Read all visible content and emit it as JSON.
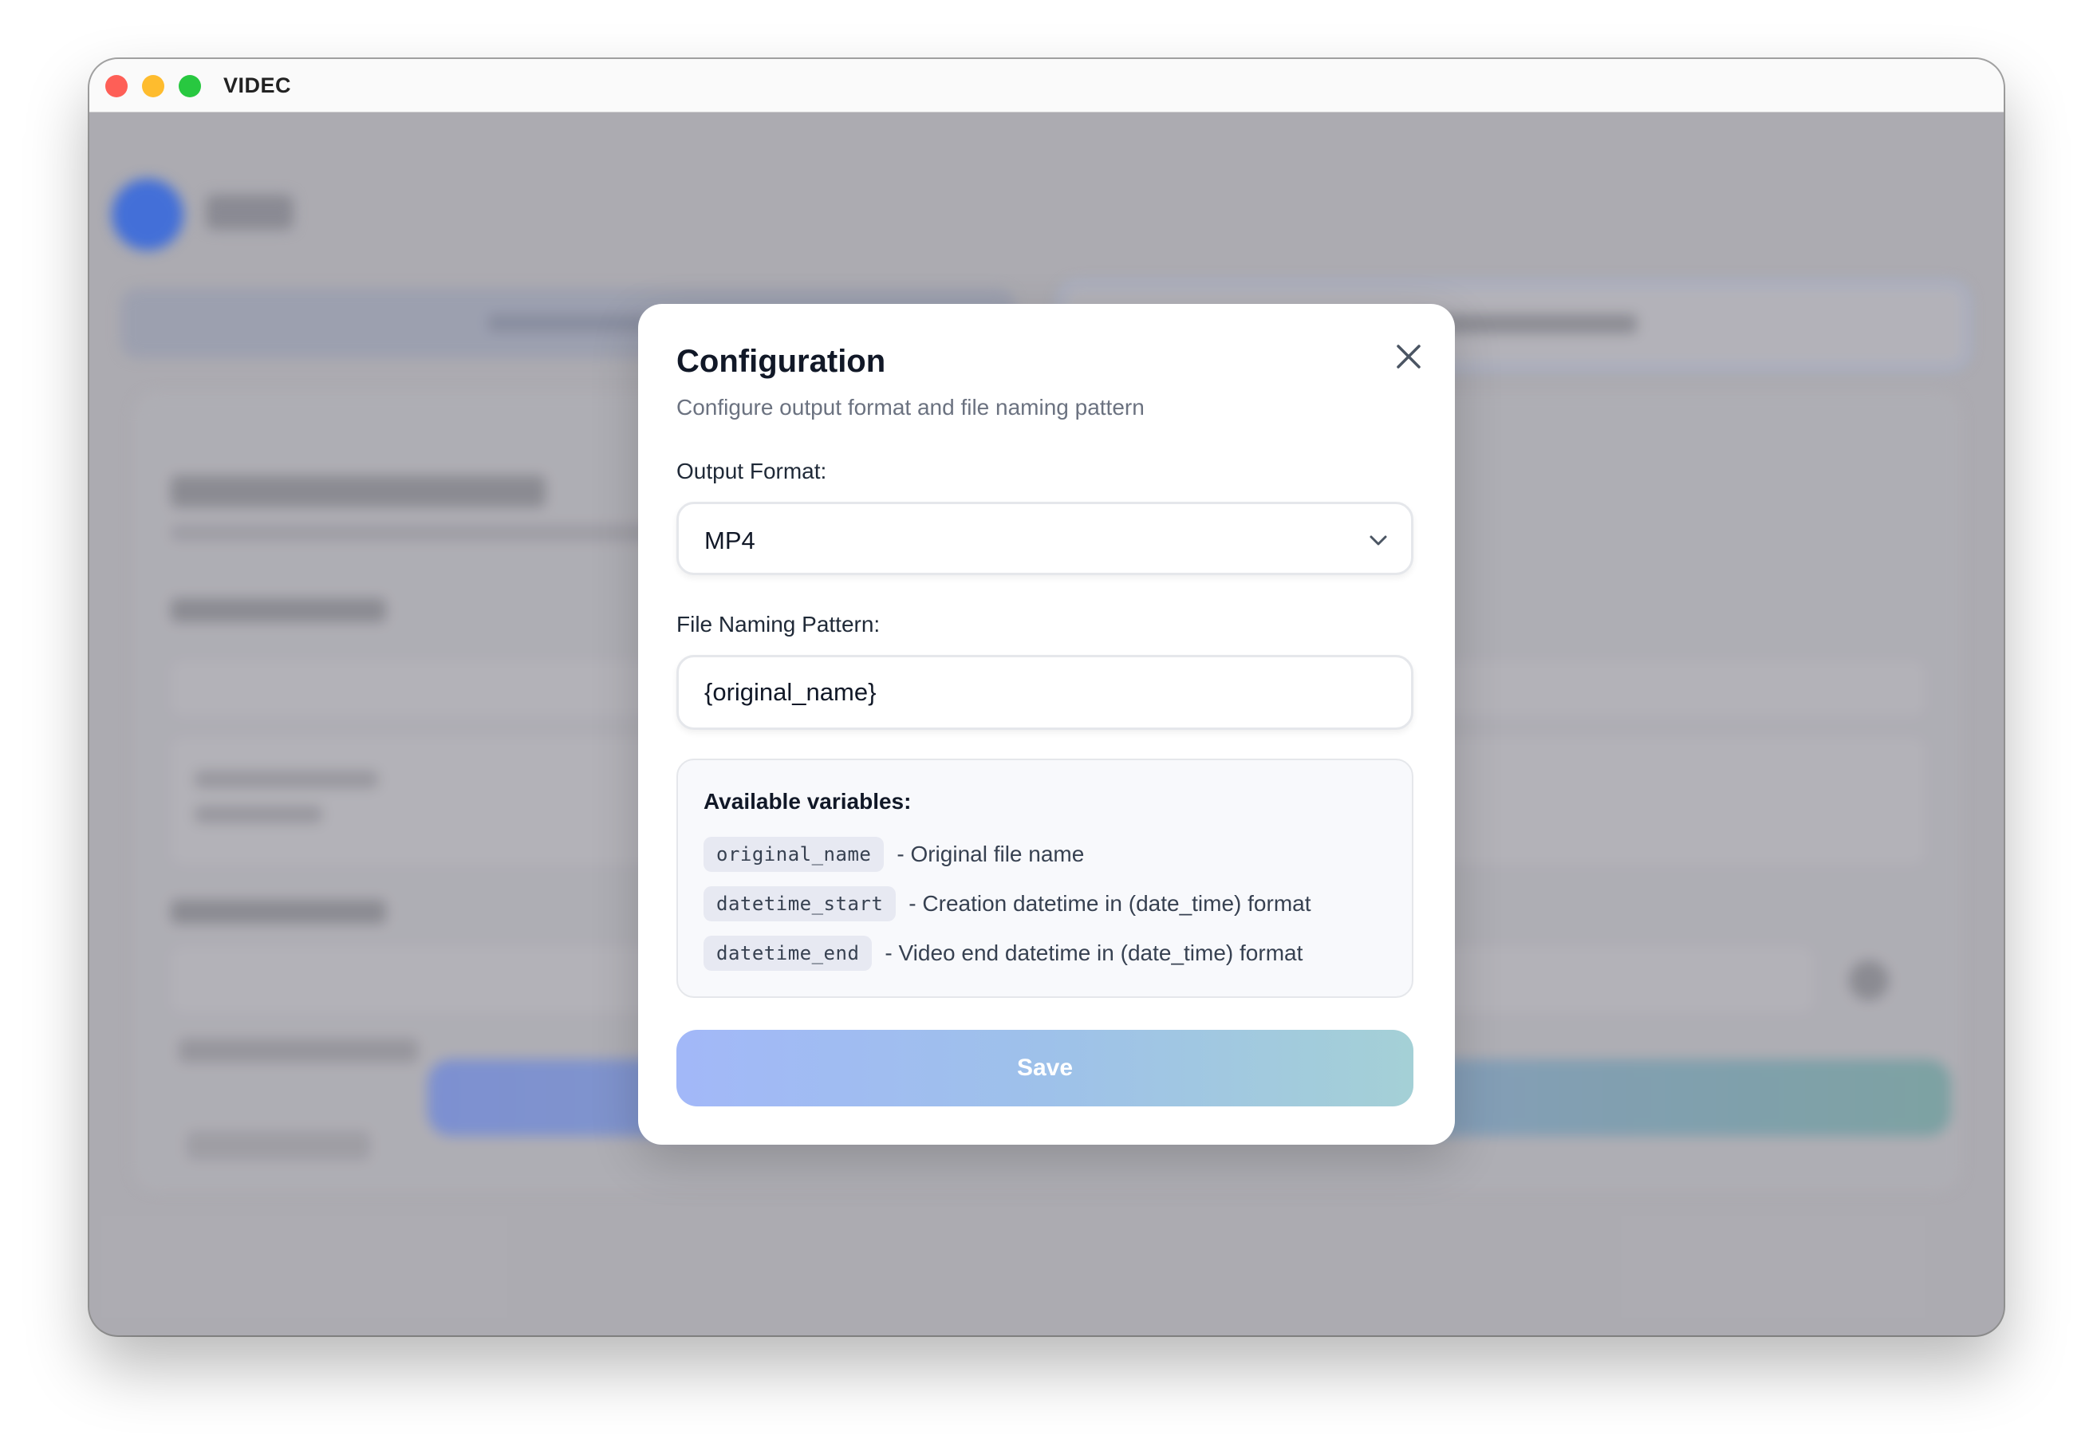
{
  "window": {
    "title": "VIDEC"
  },
  "dialog": {
    "title": "Configuration",
    "subtitle": "Configure output format and file naming pattern",
    "close_icon": "close-icon",
    "output_format": {
      "label": "Output Format:",
      "selected": "MP4"
    },
    "naming": {
      "label": "File Naming Pattern:",
      "value": "{original_name}"
    },
    "variables": {
      "title": "Available variables:",
      "items": [
        {
          "code": "original_name",
          "description": "- Original file name"
        },
        {
          "code": "datetime_start",
          "description": "- Creation datetime in (date_time) format"
        },
        {
          "code": "datetime_end",
          "description": "- Video end datetime in (date_time) format"
        }
      ]
    },
    "save_label": "Save"
  },
  "colors": {
    "traffic_red": "#fe5f57",
    "traffic_yellow": "#febc2e",
    "traffic_green": "#28c840",
    "save_gradient_start": "#a2b8f8",
    "save_gradient_end": "#a4d0d6",
    "title_text": "#111827",
    "muted_text": "#6b7280"
  }
}
